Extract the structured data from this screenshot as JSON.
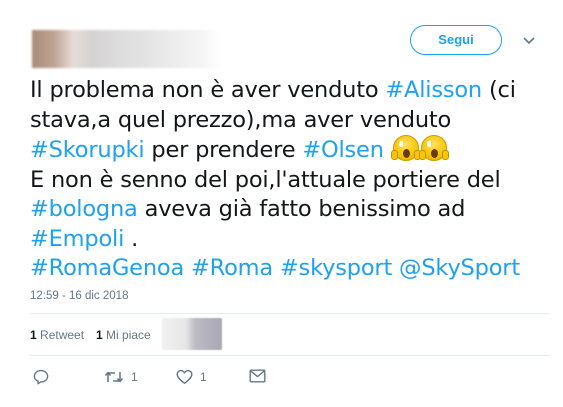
{
  "header": {
    "follow_label": "Segui"
  },
  "tweet": {
    "lines": [
      [
        {
          "t": "Il problema non è aver venduto ",
          "tag": false
        },
        {
          "t": "#Alisson",
          "tag": true
        },
        {
          "t": " (ci",
          "tag": false
        }
      ],
      [
        {
          "t": "stava,a quel prezzo),ma aver venduto",
          "tag": false
        }
      ],
      [
        {
          "t": "#Skorupki",
          "tag": true
        },
        {
          "t": " per prendere ",
          "tag": false
        },
        {
          "t": "#Olsen",
          "tag": true
        },
        {
          "t": " ",
          "tag": false
        }
      ],
      [
        {
          "t": "E non è senno del poi,l'attuale portiere del",
          "tag": false
        }
      ],
      [
        {
          "t": "#bologna",
          "tag": true
        },
        {
          "t": " aveva già fatto benissimo ad",
          "tag": false
        }
      ],
      [
        {
          "t": "#Empoli",
          "tag": true
        },
        {
          "t": " .",
          "tag": false
        }
      ],
      [
        {
          "t": "#RomaGenoa",
          "tag": true
        },
        {
          "t": " ",
          "tag": false
        },
        {
          "t": "#Roma",
          "tag": true
        },
        {
          "t": " ",
          "tag": false
        },
        {
          "t": "#skysport",
          "tag": true
        },
        {
          "t": " ",
          "tag": false
        },
        {
          "t": "@SkySport",
          "tag": true
        }
      ]
    ],
    "emoji": [
      "screaming-face-emoji",
      "screaming-face-emoji"
    ],
    "timestamp": "12:59 - 16 dic 2018"
  },
  "stats": {
    "retweet_count": "1",
    "retweet_label": "Retweet",
    "like_count": "1",
    "like_label": "Mi piace"
  },
  "actions": {
    "reply_icon": "reply-icon",
    "retweet_icon": "retweet-icon",
    "retweet_count": "1",
    "like_icon": "heart-icon",
    "like_count": "1",
    "dm_icon": "envelope-icon"
  },
  "colors": {
    "accent": "#1da1f2",
    "text": "#14171a",
    "muted": "#657786",
    "divider": "#e6ecf0"
  }
}
